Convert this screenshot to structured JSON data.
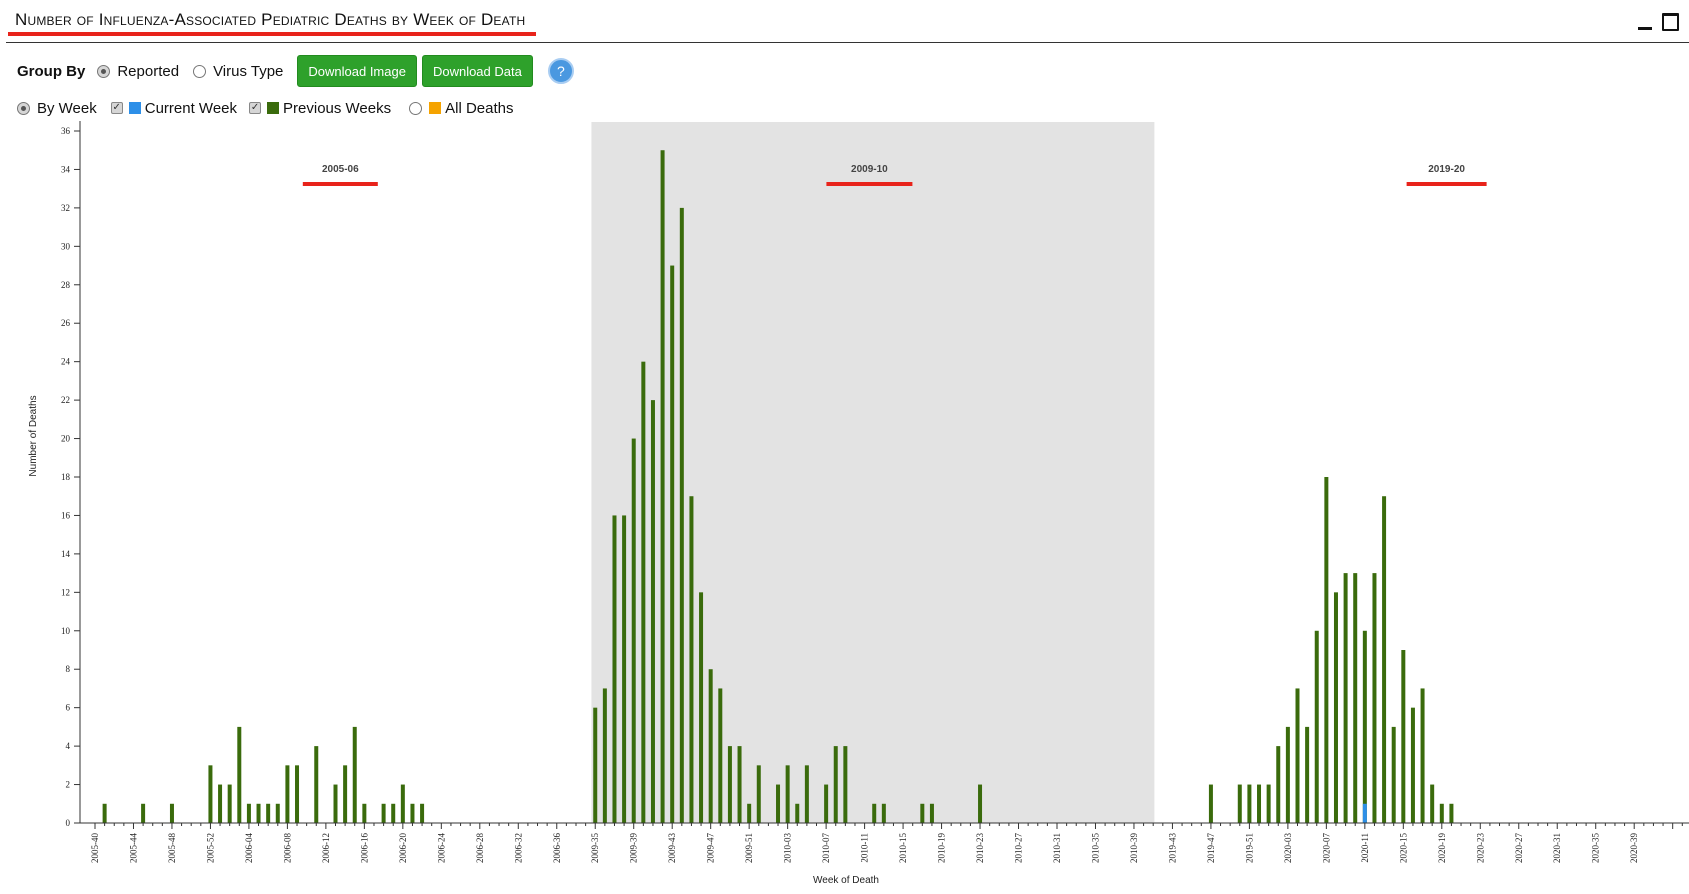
{
  "header": {
    "title": "Number of Influenza-Associated Pediatric Deaths by Week of Death"
  },
  "controls": {
    "group_by_label": "Group By",
    "reported_label": "Reported",
    "virus_type_label": "Virus Type",
    "download_image_label": "Download Image",
    "download_data_label": "Download Data",
    "help_label": "?",
    "by_week_label": "By Week",
    "current_week_label": "Current Week",
    "previous_weeks_label": "Previous Weeks",
    "all_deaths_label": "All Deaths"
  },
  "colors": {
    "previous_weeks": "#3a6b0c",
    "current_week": "#2d8fe8",
    "all_deaths": "#f5a300",
    "highlight_band": "#e3e3e3",
    "annotation": "#e8231b"
  },
  "chart_data": {
    "type": "bar",
    "xlabel": "Week of Death",
    "ylabel": "Number of Deaths",
    "ylim": [
      0,
      36
    ],
    "ytick_step": 2,
    "start_week": "2005-40",
    "x_tick_labels": [
      "2005-40",
      "2005-44",
      "2005-48",
      "2005-52",
      "2006-04",
      "2006-08",
      "2006-12",
      "2006-16",
      "2006-20",
      "2006-24",
      "2006-28",
      "2006-32",
      "2006-36",
      "2009-35",
      "2009-39",
      "2009-43",
      "2009-47",
      "2009-51",
      "2010-03",
      "2010-07",
      "2010-11",
      "2010-15",
      "2010-19",
      "2010-23",
      "2010-27",
      "2010-31",
      "2010-35",
      "2010-39",
      "2019-43",
      "2019-47",
      "2019-51",
      "2020-03",
      "2020-07",
      "2020-11",
      "2020-15",
      "2020-19",
      "2020-23",
      "2020-27",
      "2020-31",
      "2020-35",
      "2020-39"
    ],
    "seasons": [
      {
        "name": "2005-06",
        "highlighted": false
      },
      {
        "name": "2009-10",
        "highlighted": true
      },
      {
        "name": "2019-20",
        "highlighted": false
      }
    ],
    "series": [
      {
        "name": "Previous Weeks",
        "values": [
          0,
          1,
          0,
          0,
          0,
          1,
          0,
          0,
          1,
          0,
          0,
          0,
          3,
          2,
          2,
          5,
          1,
          1,
          1,
          1,
          3,
          3,
          0,
          4,
          0,
          2,
          3,
          5,
          1,
          0,
          1,
          1,
          2,
          1,
          1,
          0,
          0,
          0,
          0,
          0,
          0,
          0,
          0,
          0,
          0,
          0,
          0,
          0,
          0,
          0,
          0,
          0,
          6,
          7,
          16,
          16,
          20,
          24,
          22,
          35,
          29,
          32,
          17,
          12,
          8,
          7,
          4,
          4,
          1,
          3,
          0,
          2,
          3,
          1,
          3,
          0,
          2,
          4,
          4,
          0,
          0,
          1,
          1,
          0,
          0,
          0,
          1,
          1,
          0,
          0,
          0,
          0,
          2,
          0,
          0,
          0,
          0,
          0,
          0,
          0,
          0,
          0,
          0,
          0,
          0,
          0,
          0,
          0,
          0,
          0,
          0,
          0,
          0,
          0,
          0,
          0,
          2,
          0,
          0,
          2,
          2,
          2,
          2,
          4,
          5,
          7,
          5,
          10,
          18,
          12,
          13,
          13,
          10,
          13,
          17,
          5,
          9,
          6,
          7,
          2,
          1,
          1,
          0,
          0,
          0,
          0,
          0,
          0,
          0,
          0,
          0,
          0,
          0,
          0,
          0,
          0,
          0,
          0,
          0,
          0,
          0,
          0,
          0,
          0,
          0,
          0,
          0,
          0,
          0,
          0,
          0,
          0
        ]
      },
      {
        "name": "Current Week",
        "values": [
          0,
          0,
          0,
          0,
          0,
          0,
          0,
          0,
          0,
          0,
          0,
          0,
          0,
          0,
          0,
          0,
          0,
          0,
          0,
          0,
          0,
          0,
          0,
          0,
          0,
          0,
          0,
          0,
          0,
          0,
          0,
          0,
          0,
          0,
          0,
          0,
          0,
          0,
          0,
          0,
          0,
          0,
          0,
          0,
          0,
          0,
          0,
          0,
          0,
          0,
          0,
          0,
          0,
          0,
          0,
          0,
          0,
          0,
          0,
          0,
          0,
          0,
          0,
          0,
          0,
          0,
          0,
          0,
          0,
          0,
          0,
          0,
          0,
          0,
          0,
          0,
          0,
          0,
          0,
          0,
          0,
          0,
          0,
          0,
          0,
          0,
          0,
          0,
          0,
          0,
          0,
          0,
          0,
          0,
          0,
          0,
          0,
          0,
          0,
          0,
          0,
          0,
          0,
          0,
          0,
          0,
          0,
          0,
          0,
          0,
          0,
          0,
          0,
          0,
          0,
          0,
          0,
          0,
          0,
          0,
          0,
          0,
          0,
          0,
          0,
          0,
          0,
          0,
          0,
          0,
          0,
          0,
          1,
          0,
          0,
          0,
          0,
          0,
          0,
          0,
          0,
          0,
          0,
          0,
          0,
          0,
          0,
          0,
          0,
          0,
          0,
          0,
          0,
          0,
          0,
          0,
          0,
          0,
          0,
          0,
          0,
          0,
          0,
          0,
          0,
          0,
          0,
          0,
          0,
          0,
          0,
          0
        ]
      }
    ],
    "legend": "top-left",
    "grid": false
  }
}
